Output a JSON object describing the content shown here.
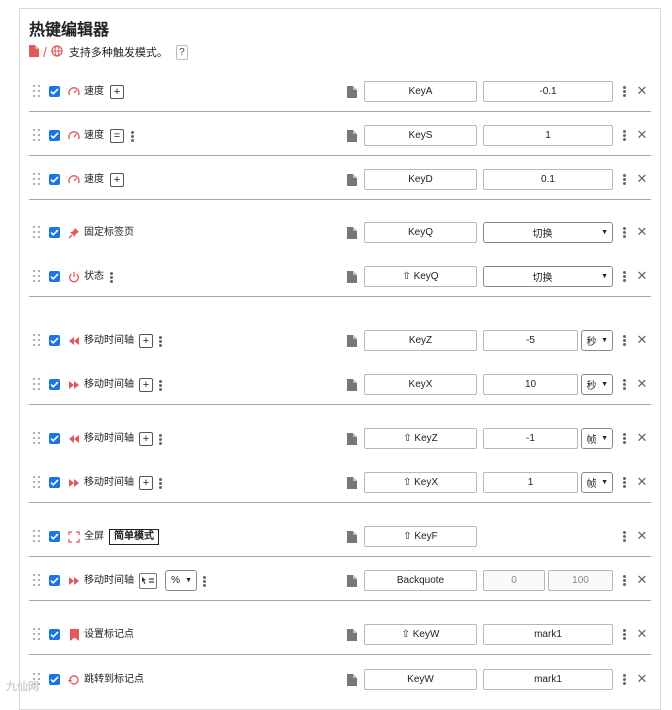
{
  "header": {
    "title": "热键编辑器",
    "subtitle": "支持多种触发模式。",
    "help_label": "?",
    "slash": "/"
  },
  "rows": [
    {
      "label": "速度",
      "key": "KeyA",
      "value": "-0.1",
      "plus": "+"
    },
    {
      "label": "速度",
      "key": "KeyS",
      "value": "1",
      "equals": "="
    },
    {
      "label": "速度",
      "key": "KeyD",
      "value": "0.1",
      "plus": "+"
    },
    {
      "label": "固定标签页",
      "key": "KeyQ",
      "select": "切换"
    },
    {
      "label": "状态",
      "key": "⇧ KeyQ",
      "select": "切换"
    },
    {
      "label": "移动时间轴",
      "key": "KeyZ",
      "value": "-5",
      "unit": "秒",
      "plus": "+"
    },
    {
      "label": "移动时间轴",
      "key": "KeyX",
      "value": "10",
      "unit": "秒",
      "plus": "+"
    },
    {
      "label": "移动时间轴",
      "key": "⇧ KeyZ",
      "value": "-1",
      "unit": "帧",
      "plus": "+"
    },
    {
      "label": "移动时间轴",
      "key": "⇧ KeyX",
      "value": "1",
      "unit": "帧",
      "plus": "+"
    },
    {
      "label": "全屏",
      "key": "⇧ KeyF",
      "mode": "简单模式"
    },
    {
      "label": "移动时间轴",
      "key": "Backquote",
      "value_from": "0",
      "value_to": "100",
      "select": "%"
    },
    {
      "label": "设置标记点",
      "key": "⇧ KeyW",
      "value": "mark1"
    },
    {
      "label": "跳转到标记点",
      "key": "KeyW",
      "value": "mark1"
    }
  ],
  "colors": {
    "accent": "#1a73e8",
    "icon_red": "#e05858"
  },
  "icons": [
    "drag-handle-icon",
    "checkbox-icon",
    "gauge-icon",
    "pin-icon",
    "power-icon",
    "rewind-icon",
    "fast-forward-icon",
    "fullscreen-icon",
    "bookmark-icon",
    "cursor-list-icon",
    "document-icon",
    "globe-icon",
    "kebab-icon",
    "close-icon"
  ],
  "watermark": "九仙网"
}
